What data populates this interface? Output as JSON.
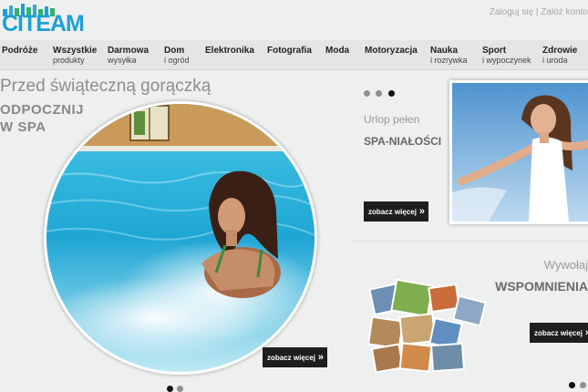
{
  "header": {
    "logo_text": "CITEAM",
    "login_label": "Zaloguj się",
    "separator": "|",
    "register_label": "Załóż konto"
  },
  "nav": [
    {
      "title": "Podróże",
      "subtitle": ""
    },
    {
      "title": "Wszystkie",
      "subtitle": "produkty"
    },
    {
      "title": "Darmowa",
      "subtitle": "wysyłka"
    },
    {
      "title": "Dom",
      "subtitle": "i ogród"
    },
    {
      "title": "Elektronika",
      "subtitle": ""
    },
    {
      "title": "Fotografia",
      "subtitle": ""
    },
    {
      "title": "Moda",
      "subtitle": ""
    },
    {
      "title": "Motoryzacja",
      "subtitle": ""
    },
    {
      "title": "Nauka",
      "subtitle": "i rozrywka"
    },
    {
      "title": "Sport",
      "subtitle": "i wypoczynek"
    },
    {
      "title": "Zdrowie",
      "subtitle": "i uroda"
    }
  ],
  "left_banner": {
    "title": "Przed świąteczną gorączką",
    "subtitle_line1": "ODPOCZNIJ",
    "subtitle_line2": "W SPA",
    "button_label": "zobacz więcej",
    "dots": 2,
    "active_dot": 0
  },
  "right_top": {
    "heading": "Urlop pełen",
    "subheading": "SPA-NIAŁOŚCI",
    "button_label": "zobacz więcej",
    "dots": 3,
    "active_dot": 2
  },
  "right_bottom": {
    "heading": "Wywołaj",
    "subheading": "WSPOMNIENIA",
    "button_label": "zobacz więcej",
    "dots": 2,
    "active_dot": 0
  },
  "colors": {
    "brand": "#1d9fd6",
    "button_bg": "#1e1e1e",
    "pool": "#22b0dc"
  },
  "icons": {
    "button_chevron": "»"
  }
}
